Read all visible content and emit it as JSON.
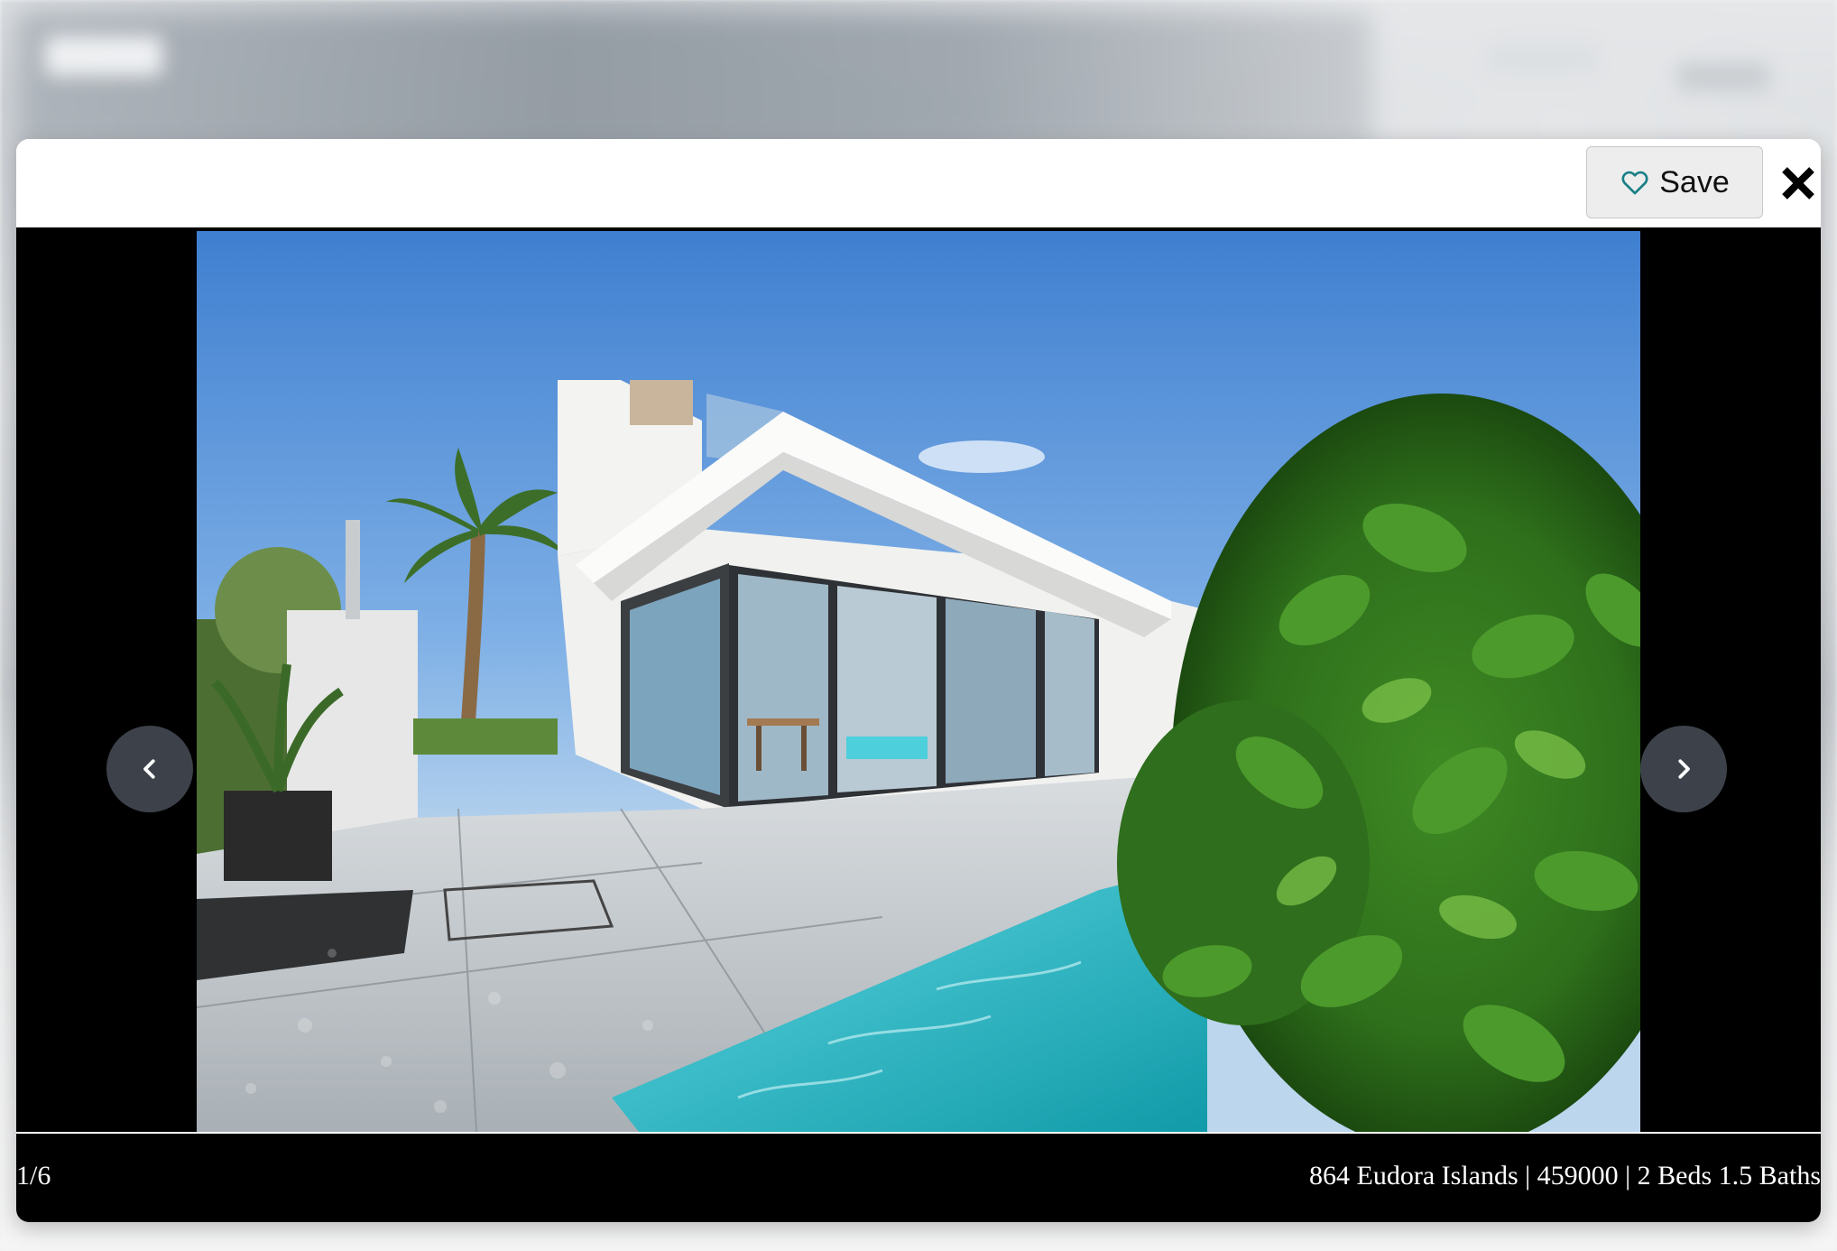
{
  "toolbar": {
    "save_label": "Save",
    "close_icon": "close-icon",
    "save_icon": "heart-outline-icon"
  },
  "gallery": {
    "counter": "1/6",
    "caption": "864 Eudora Islands | 459000 | 2 Beds 1.5 Baths",
    "prev_icon": "chevron-left-icon",
    "next_icon": "chevron-right-icon",
    "photo_subject": "modern-house-with-pool"
  },
  "colors": {
    "heart_stroke": "#1a7f86",
    "viewer_bg": "#000000",
    "nav_button_bg": "#424850"
  }
}
